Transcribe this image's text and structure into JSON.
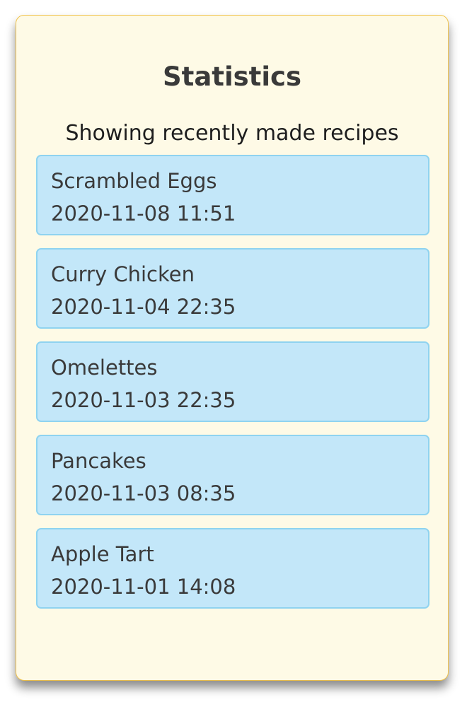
{
  "panel": {
    "title": "Statistics",
    "subtitle": "Showing recently made recipes"
  },
  "recipes": [
    {
      "name": "Scrambled Eggs",
      "made_at": "2020-11-08 11:51"
    },
    {
      "name": "Curry Chicken",
      "made_at": "2020-11-04 22:35"
    },
    {
      "name": "Omelettes",
      "made_at": "2020-11-03 22:35"
    },
    {
      "name": "Pancakes",
      "made_at": "2020-11-03 08:35"
    },
    {
      "name": "Apple Tart",
      "made_at": "2020-11-01 14:08"
    }
  ],
  "colors": {
    "panel_background": "#fefae6",
    "panel_border": "#f0c24a",
    "item_background": "#c3e7f9",
    "item_border": "#8fd3f0"
  }
}
